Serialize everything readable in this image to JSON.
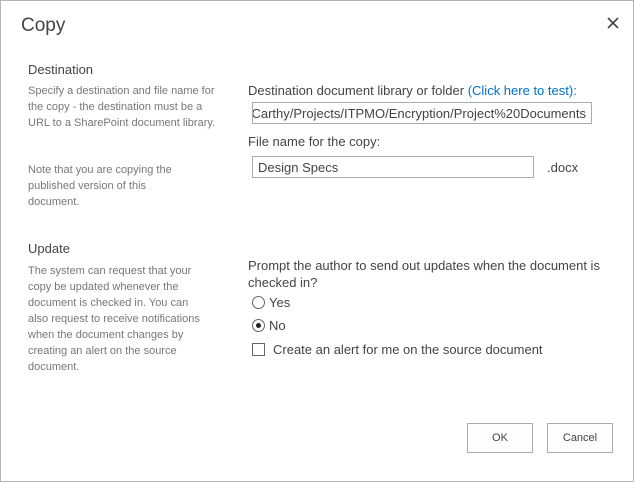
{
  "dialog": {
    "title": "Copy"
  },
  "destination": {
    "heading": "Destination",
    "description": "Specify a destination and file name for the copy - the destination must be a URL to a SharePoint document library.",
    "note": "Note that you are copying the published version of this document.",
    "folder_label": "Destination document library or folder",
    "test_link_open": "(",
    "test_link": "Click here to test",
    "test_link_close": "):",
    "folder_value": "Carthy/Projects/ITPMO/Encryption/Project%20Documents",
    "filename_label": "File name for the copy:",
    "filename_value": "Design Specs",
    "extension": ".docx"
  },
  "update": {
    "heading": "Update",
    "description": "The system can request that your copy be updated whenever the document is checked in. You can also request to receive notifications when the document changes by creating an alert on the source document.",
    "question": "Prompt the author to send out updates when the document is checked in?",
    "options": [
      {
        "label": "Yes",
        "selected": false
      },
      {
        "label": "No",
        "selected": true
      }
    ],
    "alert_label": "Create an alert for me on the source document",
    "alert_checked": false
  },
  "buttons": {
    "ok": "OK",
    "cancel": "Cancel"
  }
}
